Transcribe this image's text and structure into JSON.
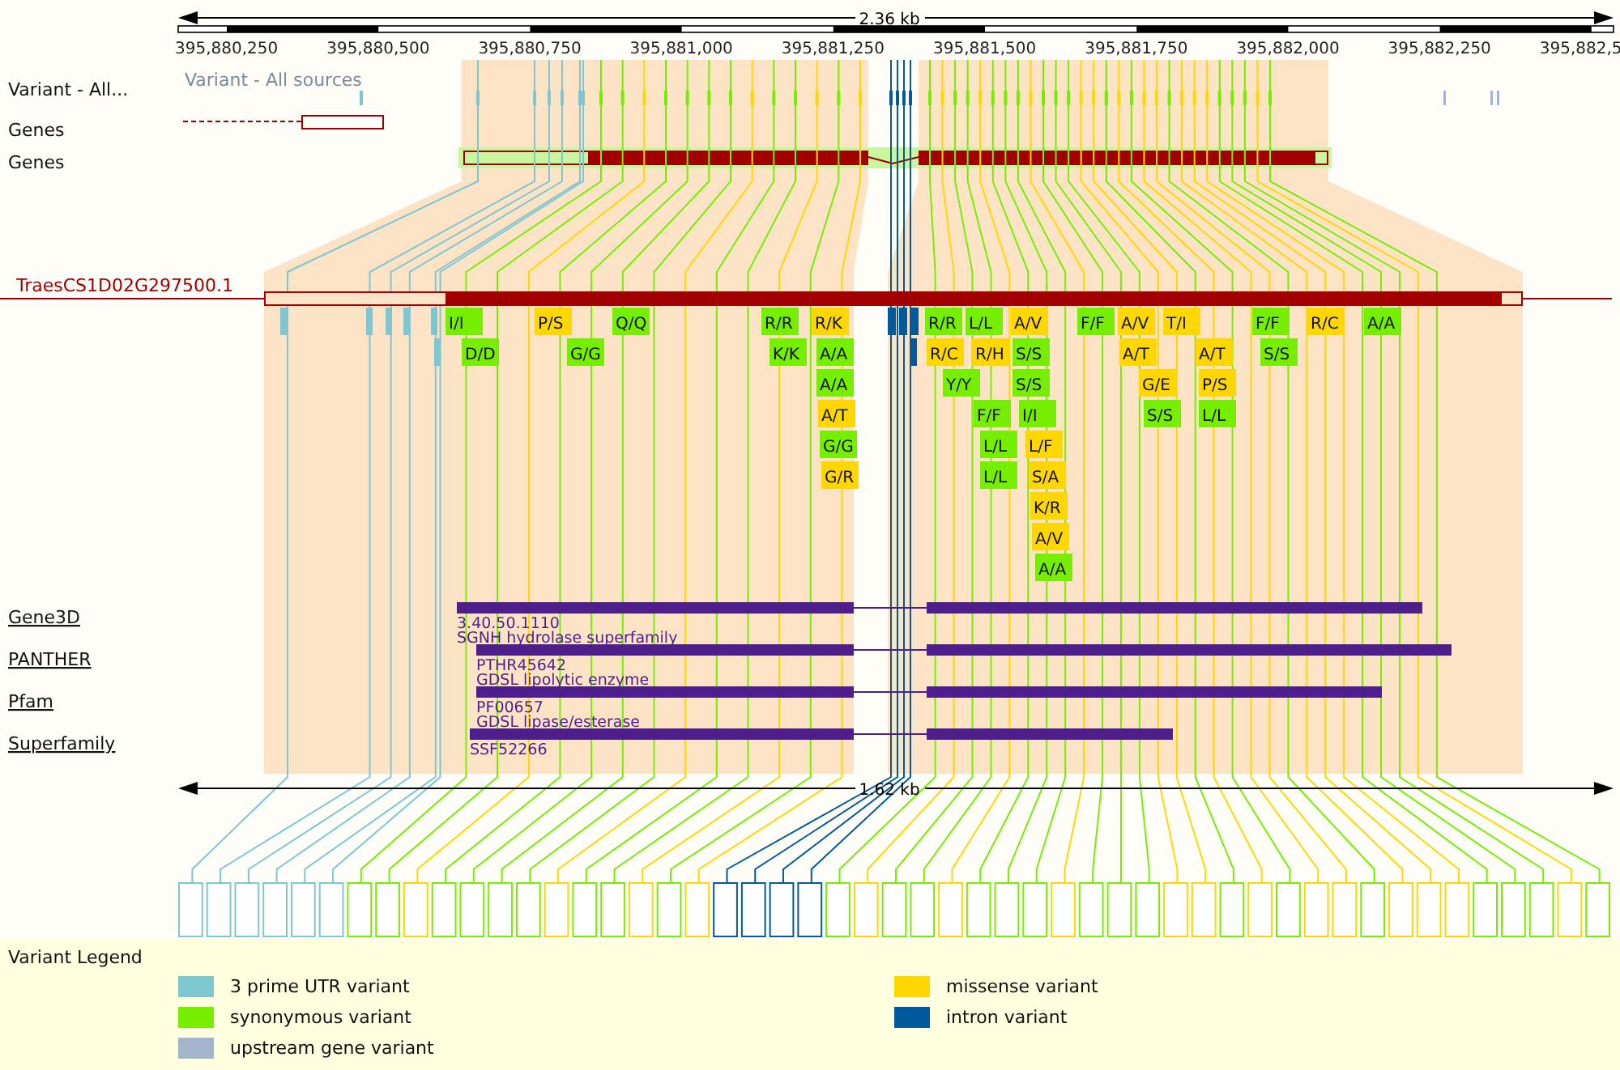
{
  "ruler": {
    "length": "2.36 kb",
    "ticks": [
      "395,880,250",
      "395,880,500",
      "395,880,750",
      "395,881,000",
      "395,881,250",
      "395,881,500",
      "395,881,750",
      "395,882,000",
      "395,882,250",
      "395,882,5"
    ]
  },
  "tracks": [
    {
      "label": "Variant - All...",
      "kind": "variants",
      "caption": "Variant - All sources"
    },
    {
      "label": "Genes",
      "kind": "upstream_gene"
    },
    {
      "label": "Genes",
      "kind": "gene"
    }
  ],
  "transcript": {
    "label": "TraesCS1D02G297500.1"
  },
  "amino_acid_changes": [
    {
      "text": "I/I",
      "color": "#76ee00"
    },
    {
      "text": "P/S",
      "color": "#ffd700"
    },
    {
      "text": "Q/Q",
      "color": "#76ee00"
    },
    {
      "text": "R/R",
      "color": "#76ee00"
    },
    {
      "text": "R/K",
      "color": "#ffd700"
    },
    {
      "text": "D/D",
      "color": "#76ee00"
    },
    {
      "text": "G/G",
      "color": "#76ee00"
    },
    {
      "text": "K/K",
      "color": "#76ee00"
    },
    {
      "text": "A/A",
      "color": "#76ee00"
    },
    {
      "text": "A/A",
      "color": "#76ee00"
    },
    {
      "text": "A/T",
      "color": "#ffd700"
    },
    {
      "text": "G/G",
      "color": "#76ee00"
    },
    {
      "text": "G/R",
      "color": "#ffd700"
    },
    {
      "text": "R/R",
      "color": "#76ee00"
    },
    {
      "text": "L/L",
      "color": "#76ee00"
    },
    {
      "text": "A/V",
      "color": "#ffd700"
    },
    {
      "text": "F/F",
      "color": "#76ee00"
    },
    {
      "text": "A/V",
      "color": "#ffd700"
    },
    {
      "text": "T/I",
      "color": "#ffd700"
    },
    {
      "text": "F/F",
      "color": "#76ee00"
    },
    {
      "text": "R/C",
      "color": "#ffd700"
    },
    {
      "text": "A/A",
      "color": "#76ee00"
    },
    {
      "text": "R/C",
      "color": "#ffd700"
    },
    {
      "text": "R/H",
      "color": "#ffd700"
    },
    {
      "text": "S/S",
      "color": "#76ee00"
    },
    {
      "text": "A/T",
      "color": "#ffd700"
    },
    {
      "text": "A/T",
      "color": "#ffd700"
    },
    {
      "text": "S/S",
      "color": "#76ee00"
    },
    {
      "text": "Y/Y",
      "color": "#76ee00"
    },
    {
      "text": "S/S",
      "color": "#76ee00"
    },
    {
      "text": "G/E",
      "color": "#ffd700"
    },
    {
      "text": "P/S",
      "color": "#ffd700"
    },
    {
      "text": "F/F",
      "color": "#76ee00"
    },
    {
      "text": "I/I",
      "color": "#76ee00"
    },
    {
      "text": "S/S",
      "color": "#76ee00"
    },
    {
      "text": "L/L",
      "color": "#76ee00"
    },
    {
      "text": "L/L",
      "color": "#76ee00"
    },
    {
      "text": "L/F",
      "color": "#ffd700"
    },
    {
      "text": "L/L",
      "color": "#76ee00"
    },
    {
      "text": "S/A",
      "color": "#ffd700"
    },
    {
      "text": "K/R",
      "color": "#ffd700"
    },
    {
      "text": "A/V",
      "color": "#ffd700"
    },
    {
      "text": "A/A",
      "color": "#76ee00"
    }
  ],
  "domains": [
    {
      "source": "Gene3D",
      "id": "3.40.50.1110",
      "description": "SGNH hydrolase superfamily"
    },
    {
      "source": "PANTHER",
      "id": "PTHR45642",
      "description": "GDSL lipolytic enzyme"
    },
    {
      "source": "Pfam",
      "id": "PF00657",
      "description": "GDSL lipase/esterase"
    },
    {
      "source": "Superfamily",
      "id": "SSF52266"
    }
  ],
  "scale": {
    "length": "1.62 kb"
  },
  "variant_columns": [
    {
      "color": "#7ec6d0"
    },
    {
      "color": "#7ec6d0"
    },
    {
      "color": "#7ec6d0"
    },
    {
      "color": "#7ec6d0"
    },
    {
      "color": "#7ec6d0"
    },
    {
      "color": "#7ec6d0"
    },
    {
      "color": "#76ee00"
    },
    {
      "color": "#76ee00"
    },
    {
      "color": "#ffd700"
    },
    {
      "color": "#76ee00"
    },
    {
      "color": "#76ee00"
    },
    {
      "color": "#76ee00"
    },
    {
      "color": "#76ee00"
    },
    {
      "color": "#ffd700"
    },
    {
      "color": "#76ee00"
    },
    {
      "color": "#76ee00"
    },
    {
      "color": "#ffd700"
    },
    {
      "color": "#76ee00"
    },
    {
      "color": "#ffd700"
    },
    {
      "color": "#02599c"
    },
    {
      "color": "#02599c"
    },
    {
      "color": "#02599c"
    },
    {
      "color": "#02599c"
    },
    {
      "color": "#76ee00"
    },
    {
      "color": "#ffd700"
    },
    {
      "color": "#76ee00"
    },
    {
      "color": "#76ee00"
    },
    {
      "color": "#ffd700"
    },
    {
      "color": "#76ee00"
    },
    {
      "color": "#76ee00"
    },
    {
      "color": "#76ee00"
    },
    {
      "color": "#ffd700"
    },
    {
      "color": "#76ee00"
    },
    {
      "color": "#76ee00"
    },
    {
      "color": "#76ee00"
    },
    {
      "color": "#ffd700"
    },
    {
      "color": "#ffd700"
    },
    {
      "color": "#76ee00"
    },
    {
      "color": "#ffd700"
    },
    {
      "color": "#76ee00"
    },
    {
      "color": "#ffd700"
    },
    {
      "color": "#ffd700"
    },
    {
      "color": "#76ee00"
    },
    {
      "color": "#ffd700"
    },
    {
      "color": "#ffd700"
    },
    {
      "color": "#ffd700"
    },
    {
      "color": "#76ee00"
    },
    {
      "color": "#76ee00"
    },
    {
      "color": "#76ee00"
    },
    {
      "color": "#ffd700"
    },
    {
      "color": "#76ee00"
    }
  ],
  "legend": {
    "title": "Variant Legend",
    "items": [
      {
        "label": "3 prime UTR variant",
        "color": "#7ec6d0"
      },
      {
        "label": "missense variant",
        "color": "#ffd700"
      },
      {
        "label": "synonymous variant",
        "color": "#76ee00"
      },
      {
        "label": "intron variant",
        "color": "#02599c"
      },
      {
        "label": "upstream gene variant",
        "color": "#a2b5cd"
      }
    ]
  }
}
